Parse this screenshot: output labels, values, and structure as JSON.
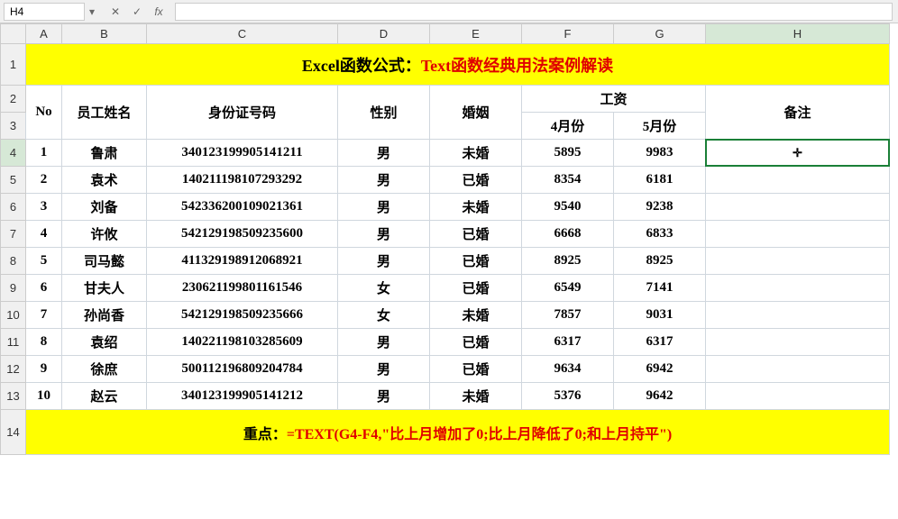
{
  "name_box": "H4",
  "formula_value": "",
  "columns": [
    "A",
    "B",
    "C",
    "D",
    "E",
    "F",
    "G",
    "H"
  ],
  "selected_col": "H",
  "selected_row": 4,
  "title_black": "Excel函数公式：",
  "title_red": "Text函数经典用法案例解读",
  "headers": {
    "no": "No",
    "name": "员工姓名",
    "id": "身份证号码",
    "gender": "性别",
    "marital": "婚姻",
    "salary": "工资",
    "april": "4月份",
    "may": "5月份",
    "remark": "备注"
  },
  "rows": [
    {
      "no": "1",
      "name": "鲁肃",
      "id": "340123199905141211",
      "gender": "男",
      "marital": "未婚",
      "apr": "5895",
      "may": "9983",
      "rem": ""
    },
    {
      "no": "2",
      "name": "袁术",
      "id": "140211198107293292",
      "gender": "男",
      "marital": "已婚",
      "apr": "8354",
      "may": "6181",
      "rem": ""
    },
    {
      "no": "3",
      "name": "刘备",
      "id": "542336200109021361",
      "gender": "男",
      "marital": "未婚",
      "apr": "9540",
      "may": "9238",
      "rem": ""
    },
    {
      "no": "4",
      "name": "许攸",
      "id": "542129198509235600",
      "gender": "男",
      "marital": "已婚",
      "apr": "6668",
      "may": "6833",
      "rem": ""
    },
    {
      "no": "5",
      "name": "司马懿",
      "id": "411329198912068921",
      "gender": "男",
      "marital": "已婚",
      "apr": "8925",
      "may": "8925",
      "rem": ""
    },
    {
      "no": "6",
      "name": "甘夫人",
      "id": "230621199801161546",
      "gender": "女",
      "marital": "已婚",
      "apr": "6549",
      "may": "7141",
      "rem": ""
    },
    {
      "no": "7",
      "name": "孙尚香",
      "id": "542129198509235666",
      "gender": "女",
      "marital": "未婚",
      "apr": "7857",
      "may": "9031",
      "rem": ""
    },
    {
      "no": "8",
      "name": "袁绍",
      "id": "140221198103285609",
      "gender": "男",
      "marital": "已婚",
      "apr": "6317",
      "may": "6317",
      "rem": ""
    },
    {
      "no": "9",
      "name": "徐庶",
      "id": "500112196809204784",
      "gender": "男",
      "marital": "已婚",
      "apr": "9634",
      "may": "6942",
      "rem": ""
    },
    {
      "no": "10",
      "name": "赵云",
      "id": "340123199905141212",
      "gender": "男",
      "marital": "未婚",
      "apr": "5376",
      "may": "9642",
      "rem": ""
    }
  ],
  "footer_label": "重点：",
  "footer_formula": "=TEXT(G4-F4,\"比上月增加了0;比上月降低了0;和上月持平\")"
}
